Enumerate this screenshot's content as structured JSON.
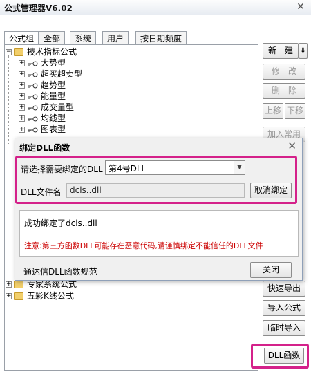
{
  "window": {
    "title": "公式管理器V6.02",
    "close_icon": "close-icon"
  },
  "tabs": [
    {
      "label": "公式组",
      "active": true
    },
    {
      "label": "全部"
    },
    {
      "label": "系统"
    },
    {
      "label": "用户"
    },
    {
      "label": "按日期频度"
    }
  ],
  "tree": {
    "root": "技术指标公式",
    "children": [
      "大势型",
      "超买超卖型",
      "趋势型",
      "能量型",
      "成交量型",
      "均线型",
      "图表型"
    ],
    "more_roots": [
      "专家系统公式",
      "五彩K线公式"
    ]
  },
  "sidebar": {
    "new": "新　建",
    "modify": "修　改",
    "delete": "删　除",
    "move_up": "上移",
    "move_down": "下移",
    "add_common": "加入常用",
    "fast_export": "快速导出",
    "import": "导入公式",
    "temp_import": "临时导入",
    "dll": "DLL函数"
  },
  "dialog": {
    "title": "绑定DLL函数",
    "select_label": "请选择需要绑定的DLL",
    "select_value": "第4号DLL",
    "file_label": "DLL文件名",
    "file_value": "dcls..dll",
    "unbind_button": "取消绑定",
    "info_text": "成功绑定了dcls..dll",
    "warning_text": "注意:第三方函数DLL可能存在恶意代码,请谨慎绑定不能信任的DLL文件",
    "link_text": "通达信DLL函数规范",
    "close_button": "关闭"
  },
  "colors": {
    "highlight": "#d4218a",
    "warning": "#cc0000",
    "folder": "#f2cf6b"
  }
}
